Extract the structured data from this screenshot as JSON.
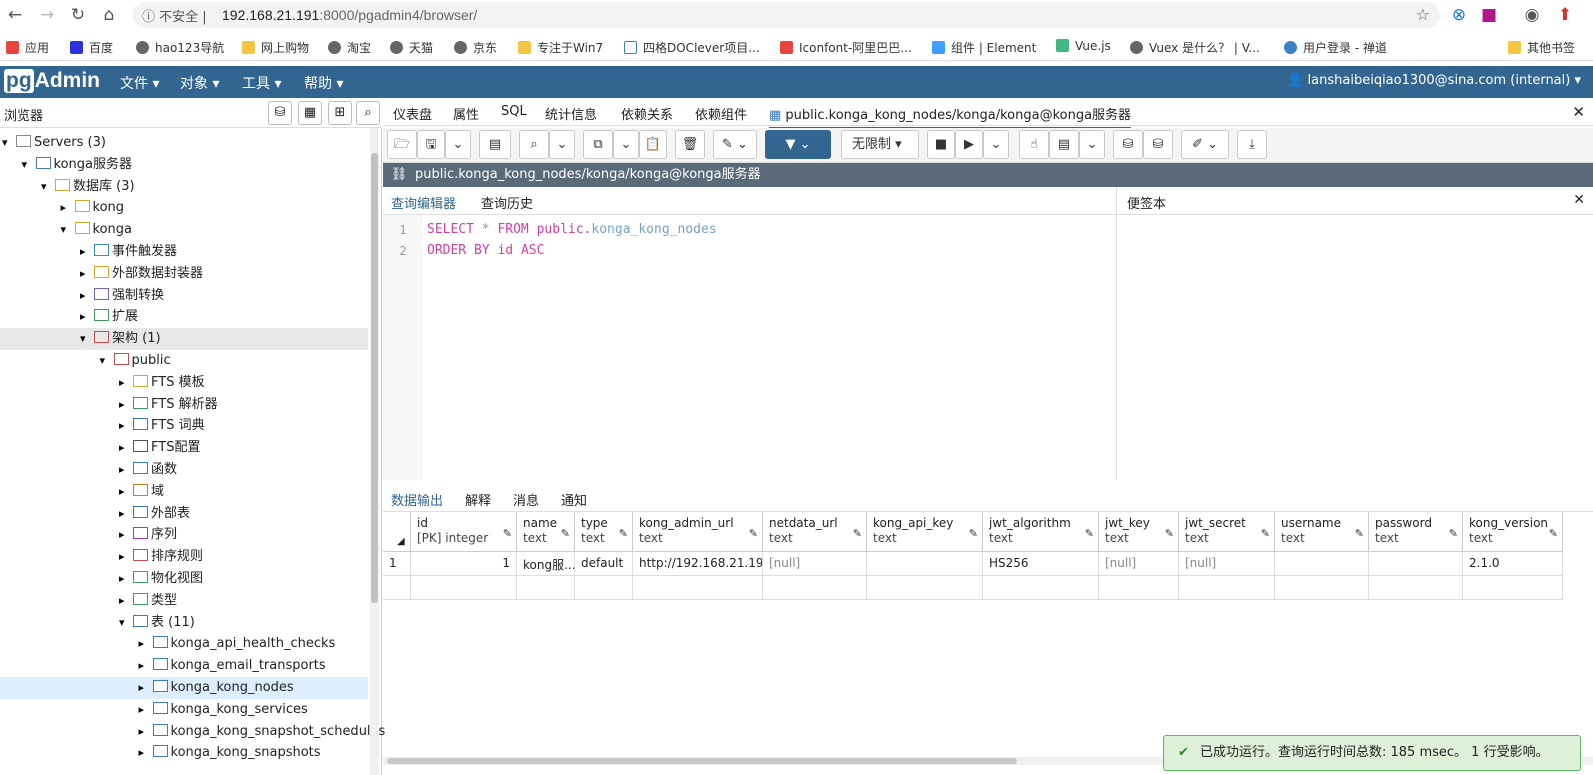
{
  "browser": {
    "insecure_label": "不安全",
    "url_host": "192.168.21.191",
    "url_rest": ":8000/pgadmin4/browser/",
    "bookmarks": [
      "应用",
      "百度",
      "hao123导航",
      "网上购物",
      "淘宝",
      "天猫",
      "京东",
      "专注于Win7",
      "四格DOClever项目...",
      "Iconfont-阿里巴巴...",
      "组件 | Element",
      "Vue.js",
      "Vuex 是什么？ | V...",
      "用户登录 - 禅道",
      "其他书签"
    ]
  },
  "app": {
    "logo_pg": "pg",
    "logo_admin": "Admin",
    "menus": [
      "文件",
      "对象",
      "工具",
      "帮助"
    ],
    "user": "lanshaibeiqiao1300@sina.com (internal)"
  },
  "browser_panel": {
    "title": "浏览器",
    "tree": [
      {
        "label": "Servers (3)",
        "indent": 0,
        "arrow": "⌄"
      },
      {
        "label": "konga服务器",
        "indent": 1,
        "arrow": "⌄"
      },
      {
        "label": "数据库 (3)",
        "indent": 2,
        "arrow": "⌄"
      },
      {
        "label": "kong",
        "indent": 3,
        "arrow": "›"
      },
      {
        "label": "konga",
        "indent": 3,
        "arrow": "⌄"
      },
      {
        "label": "事件触发器",
        "indent": 4,
        "arrow": "›"
      },
      {
        "label": "外部数据封装器",
        "indent": 4,
        "arrow": "›"
      },
      {
        "label": "强制转换",
        "indent": 4,
        "arrow": "›"
      },
      {
        "label": "扩展",
        "indent": 4,
        "arrow": "›"
      },
      {
        "label": "架构 (1)",
        "indent": 4,
        "arrow": "⌄"
      },
      {
        "label": "public",
        "indent": 5,
        "arrow": "⌄"
      },
      {
        "label": "FTS 模板",
        "indent": 6,
        "arrow": "›"
      },
      {
        "label": "FTS 解析器",
        "indent": 6,
        "arrow": "›"
      },
      {
        "label": "FTS 词典",
        "indent": 6,
        "arrow": "›"
      },
      {
        "label": "FTS配置",
        "indent": 6,
        "arrow": "›"
      },
      {
        "label": "函数",
        "indent": 6,
        "arrow": "›"
      },
      {
        "label": "域",
        "indent": 6,
        "arrow": "›"
      },
      {
        "label": "外部表",
        "indent": 6,
        "arrow": "›"
      },
      {
        "label": "序列",
        "indent": 6,
        "arrow": "›"
      },
      {
        "label": "排序规则",
        "indent": 6,
        "arrow": "›"
      },
      {
        "label": "物化视图",
        "indent": 6,
        "arrow": "›"
      },
      {
        "label": "类型",
        "indent": 6,
        "arrow": "›"
      },
      {
        "label": "表 (11)",
        "indent": 6,
        "arrow": "⌄"
      },
      {
        "label": "konga_api_health_checks",
        "indent": 7,
        "arrow": "›"
      },
      {
        "label": "konga_email_transports",
        "indent": 7,
        "arrow": "›"
      },
      {
        "label": "konga_kong_nodes",
        "indent": 7,
        "arrow": "›"
      },
      {
        "label": "konga_kong_services",
        "indent": 7,
        "arrow": "›"
      },
      {
        "label": "konga_kong_snapshot_schedules",
        "indent": 7,
        "arrow": "›"
      },
      {
        "label": "konga_kong_snapshots",
        "indent": 7,
        "arrow": "›"
      }
    ]
  },
  "main_tabs": [
    "仪表盘",
    "属性",
    "SQL",
    "统计信息",
    "依赖关系",
    "依赖组件",
    "public.konga_kong_nodes/konga/konga@konga服务器"
  ],
  "toolbar": {
    "limit_label": "无限制"
  },
  "panel_title": "public.konga_kong_nodes/konga/konga@konga服务器",
  "query_tabs": [
    "查询编辑器",
    "查询历史"
  ],
  "notes_title": "便签本",
  "editor": {
    "line_numbers": [
      "1",
      "2"
    ],
    "kw_select": "SELECT",
    "star": " * ",
    "kw_from": "FROM",
    "schema": " public.",
    "table": "konga_kong_nodes",
    "kw_order": "ORDER BY",
    "col": " id ",
    "kw_asc": "ASC"
  },
  "output_tabs": [
    "数据输出",
    "解释",
    "消息",
    "通知"
  ],
  "grid": {
    "columns": [
      {
        "name": "id",
        "type": "[PK] integer"
      },
      {
        "name": "name",
        "type": "text"
      },
      {
        "name": "type",
        "type": "text"
      },
      {
        "name": "kong_admin_url",
        "type": "text"
      },
      {
        "name": "netdata_url",
        "type": "text"
      },
      {
        "name": "kong_api_key",
        "type": "text"
      },
      {
        "name": "jwt_algorithm",
        "type": "text"
      },
      {
        "name": "jwt_key",
        "type": "text"
      },
      {
        "name": "jwt_secret",
        "type": "text"
      },
      {
        "name": "username",
        "type": "text"
      },
      {
        "name": "password",
        "type": "text"
      },
      {
        "name": "kong_version",
        "type": "text"
      }
    ],
    "row_number": "1",
    "rows": [
      [
        "1",
        "kong服...",
        "default",
        "http://192.168.21.19...",
        "[null]",
        "",
        "HS256",
        "[null]",
        "[null]",
        "",
        "",
        "2.1.0"
      ]
    ]
  },
  "toast": "已成功运行。查询运行时间总数: 185 msec。 1 行受影响。"
}
